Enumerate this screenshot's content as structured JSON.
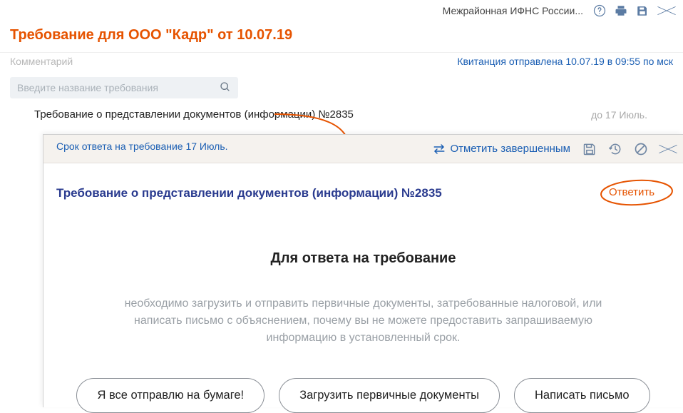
{
  "header": {
    "org_name": "Межрайонная ИФНС России..."
  },
  "page": {
    "title": "Требование для ООО \"Кадр\" от 10.07.19",
    "comment_placeholder": "Комментарий",
    "receipt_status": "Квитанция отправлена 10.07.19 в 09:55 по мск",
    "search_placeholder": "Введите название требования"
  },
  "requirement": {
    "label": "Требование о представлении документов (информации) №2835",
    "deadline": "до 17 Июль."
  },
  "panel": {
    "deadline_text": "Срок ответа на требование 17 Июль.",
    "mark_complete_label": "Отметить завершенным",
    "req_title": "Требование о представлении документов (информации) №2835",
    "reply_label": "Ответить",
    "body_heading": "Для ответа на требование",
    "body_text": "необходимо загрузить и отправить первичные документы, затребованные налоговой, или написать письмо с объяснением, почему вы не можете предоставить запрашиваемую информацию в установленный срок.",
    "actions": {
      "send_paper": "Я все отправлю на бумаге!",
      "upload_docs": "Загрузить первичные документы",
      "write_letter": "Написать письмо"
    }
  }
}
